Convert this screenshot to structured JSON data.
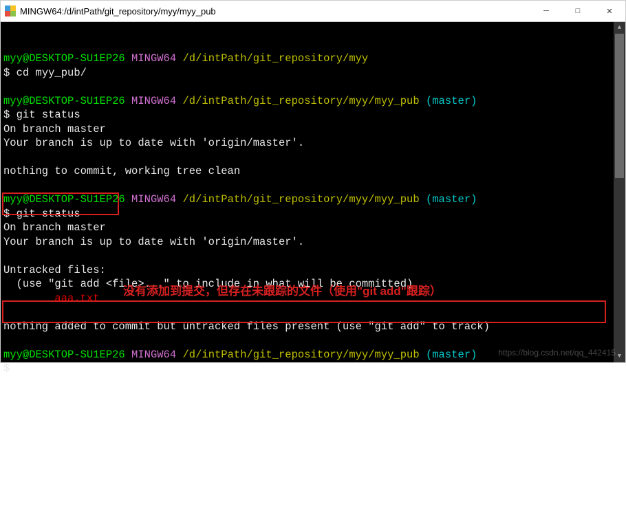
{
  "window": {
    "title": "MINGW64:/d/intPath/git_repository/myy/myy_pub"
  },
  "prompt": {
    "user_host": "myy@DESKTOP-SU1EP26",
    "shell": "MINGW64",
    "path1": "/d/intPath/git_repository/myy",
    "path2": "/d/intPath/git_repository/myy/myy_pub",
    "branch": "(master)",
    "ps": "$ "
  },
  "cmd": {
    "cd": "cd myy_pub/",
    "gitstatus": "git status"
  },
  "out": {
    "on_branch": "On branch master",
    "uptodate": "Your branch is up to date with 'origin/master'.",
    "nothing_clean": "nothing to commit, working tree clean",
    "untracked_hdr": "Untracked files:",
    "untracked_hint": "  (use \"git add <file>...\" to include in what will be committed)",
    "untracked_file": "        aaa.txt",
    "nothing_added": "nothing added to commit but untracked files present (use \"git add\" to track)"
  },
  "annotation": {
    "text": "没有添加到提交，但存在未跟踪的文件（使用\"git add\"跟踪）"
  },
  "watermark": "https://blog.csdn.net/qq_442415"
}
